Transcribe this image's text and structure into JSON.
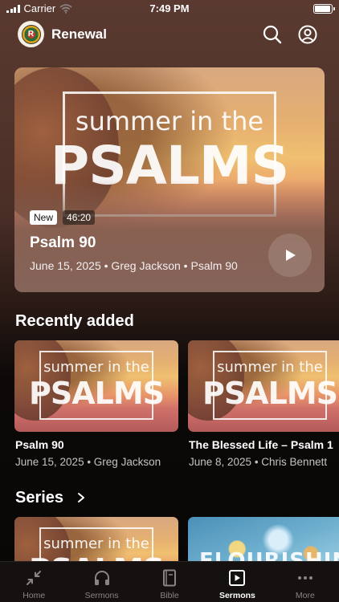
{
  "status_bar": {
    "carrier": "Carrier",
    "time": "7:49 PM",
    "battery_level": 0.95
  },
  "header": {
    "app_name": "Renewal",
    "logo_letter": "R"
  },
  "featured": {
    "art_line1": "summer in the",
    "art_line2": "PSALMS",
    "badge_new": "New",
    "duration": "46:20",
    "title": "Psalm 90",
    "meta": "June 15, 2025 • Greg Jackson • Psalm 90"
  },
  "recently_added": {
    "heading": "Recently added",
    "items": [
      {
        "art_line1": "summer in the",
        "art_line2": "PSALMS",
        "title": "Psalm 90",
        "meta": "June 15, 2025 • Greg Jackson"
      },
      {
        "art_line1": "summer in the",
        "art_line2": "PSALMS",
        "title": "The Blessed Life – Psalm 1",
        "meta": "June 8, 2025 • Chris Bennett"
      }
    ]
  },
  "series": {
    "heading": "Series",
    "items": [
      {
        "art_line1": "summer in the",
        "art_line2": "PSALMS"
      },
      {
        "art_text": "FLOURISHING"
      }
    ]
  },
  "tab_bar": {
    "tabs": [
      {
        "label": "Home",
        "icon": "collapse-arrows-icon",
        "active": false
      },
      {
        "label": "Sermons",
        "icon": "headphones-icon",
        "active": false
      },
      {
        "label": "Bible",
        "icon": "book-icon",
        "active": false
      },
      {
        "label": "Sermons",
        "icon": "play-square-icon",
        "active": true
      },
      {
        "label": "More",
        "icon": "more-dots-icon",
        "active": false
      }
    ]
  }
}
